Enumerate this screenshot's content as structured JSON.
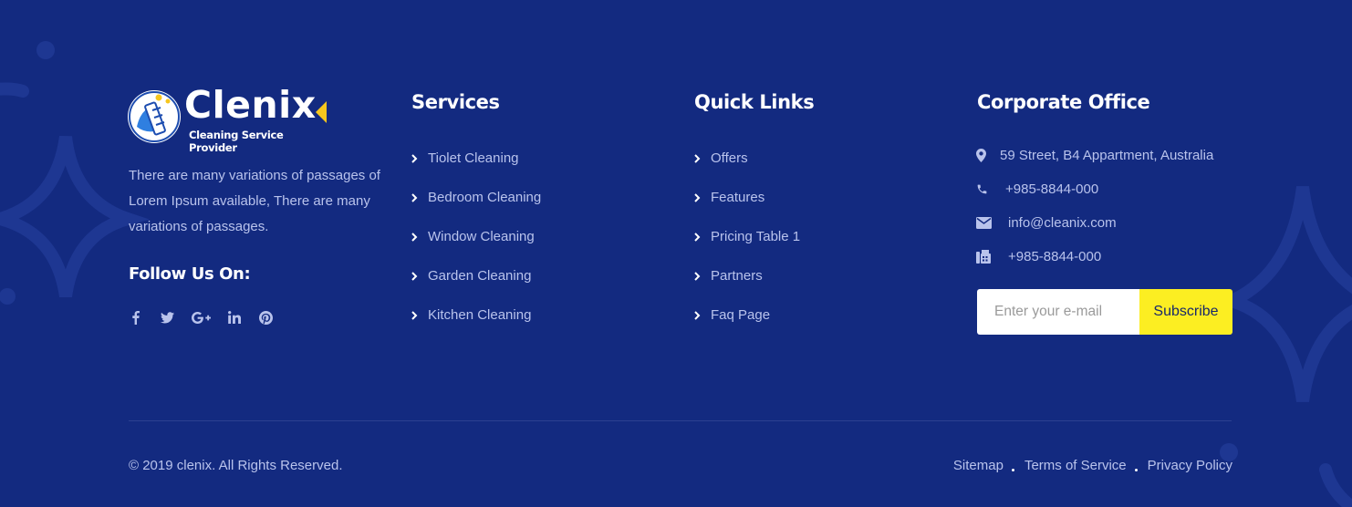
{
  "brand": {
    "name": "Clenix",
    "tagline": "Cleaning Service Provider"
  },
  "about": {
    "text": "There are many variations of passages of Lorem Ipsum available, There are many variations of passages.",
    "follow_label": "Follow Us On:"
  },
  "social": [
    "facebook-icon",
    "twitter-icon",
    "google-plus-icon",
    "linkedin-icon",
    "pinterest-icon"
  ],
  "services": {
    "title": "Services",
    "items": [
      "Tiolet Cleaning",
      "Bedroom Cleaning",
      "Window Cleaning",
      "Garden Cleaning",
      "Kitchen Cleaning"
    ]
  },
  "quick_links": {
    "title": "Quick Links",
    "items": [
      "Offers",
      "Features",
      "Pricing Table 1",
      "Partners",
      "Faq Page"
    ]
  },
  "office": {
    "title": "Corporate Office",
    "address": "59 Street, B4 Appartment, Australia",
    "phone": "+985-8844-000",
    "email": "info@cleanix.com",
    "fax": "+985-8844-000"
  },
  "subscribe": {
    "placeholder": "Enter your e-mail",
    "button": "Subscribe"
  },
  "footer": {
    "copyright": "© 2019 clenix. All Rights Reserved.",
    "links": [
      "Sitemap",
      "Terms of Service",
      "Privacy Policy"
    ]
  },
  "colors": {
    "background": "#132a80",
    "accent": "#fcee22",
    "text": "#b9c3ec",
    "heading": "#ffffff"
  }
}
